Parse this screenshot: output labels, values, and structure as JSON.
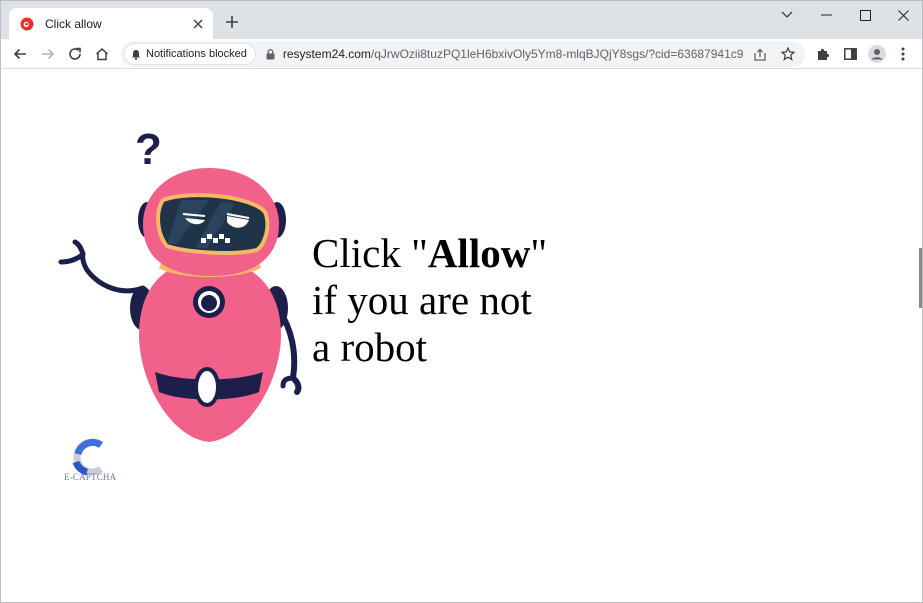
{
  "tab": {
    "title": "Click allow"
  },
  "toolbar": {
    "permission_chip": "Notifications blocked",
    "url_host": "resystem24.com",
    "url_path": "/qJrwOzii8tuzPQ1leH6bxivOly5Ym8-mlqBJQjY8sgs/?cid=63687941c9e..."
  },
  "page": {
    "headline_pre": "Click \"",
    "headline_bold": "Allow",
    "headline_post": "\"",
    "headline_line2": "if you are not",
    "headline_line3": "a robot",
    "question_mark": "?",
    "captcha_label": "E-CAPTCHA"
  },
  "icons": {
    "favicon": "red-circle-favicon",
    "back": "back-arrow-icon",
    "forward": "forward-arrow-icon",
    "reload": "reload-icon",
    "home": "home-icon",
    "bell": "bell-icon",
    "lock": "lock-icon",
    "share": "share-icon",
    "star": "star-icon",
    "extensions": "puzzle-icon",
    "side_panel": "side-panel-icon",
    "profile": "profile-icon",
    "menu": "kebab-menu-icon"
  },
  "colors": {
    "robot_body": "#f2618a",
    "robot_visor": "#1f3448",
    "robot_collar": "#f6b865",
    "robot_dark": "#1d1f4b",
    "favicon": "#e8312f",
    "captcha_blue": "#3f6fd8"
  }
}
